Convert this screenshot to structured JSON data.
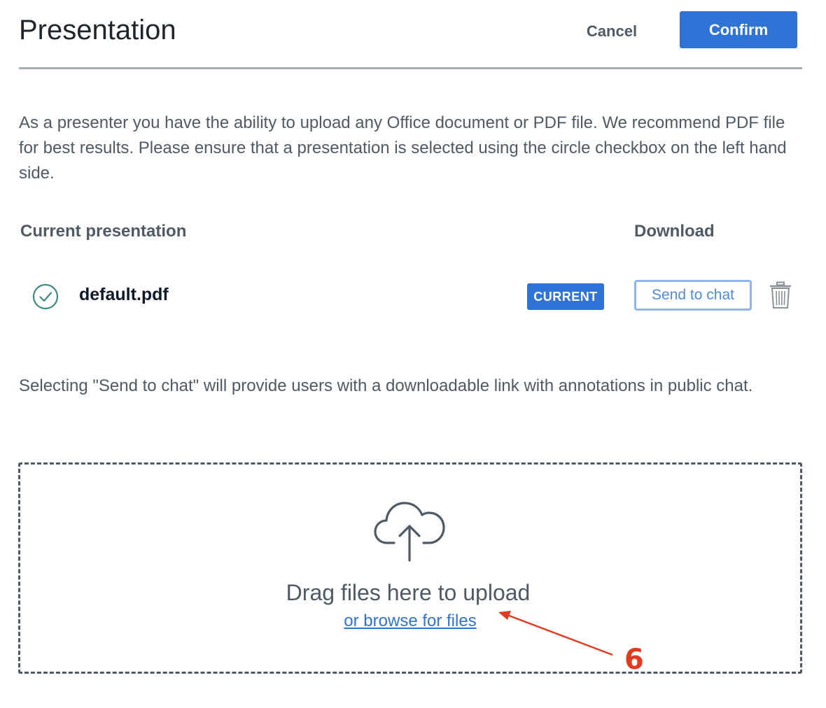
{
  "header": {
    "title": "Presentation",
    "cancel_label": "Cancel",
    "confirm_label": "Confirm"
  },
  "intro_text": "As a presenter you have the ability to upload any Office document or PDF file. We recommend PDF file for best results. Please ensure that a presentation is selected using the circle checkbox on the left hand side.",
  "table": {
    "current_header": "Current presentation",
    "download_header": "Download"
  },
  "presentations": [
    {
      "filename": "default.pdf",
      "selected": true,
      "badge": "CURRENT",
      "send_label": "Send to chat"
    }
  ],
  "chat_note": "Selecting \"Send to chat\" will provide users with a downloadable link with annotations in public chat.",
  "dropzone": {
    "drag_text": "Drag files here to upload",
    "browse_text": "or browse for files"
  },
  "annotation": {
    "step": "6"
  },
  "icons": {
    "check": "check-circle-icon",
    "trash": "trash-icon",
    "upload": "cloud-upload-icon"
  },
  "colors": {
    "accent": "#2f73d6",
    "text": "#4e5a66",
    "annotation": "#e23a1e"
  }
}
